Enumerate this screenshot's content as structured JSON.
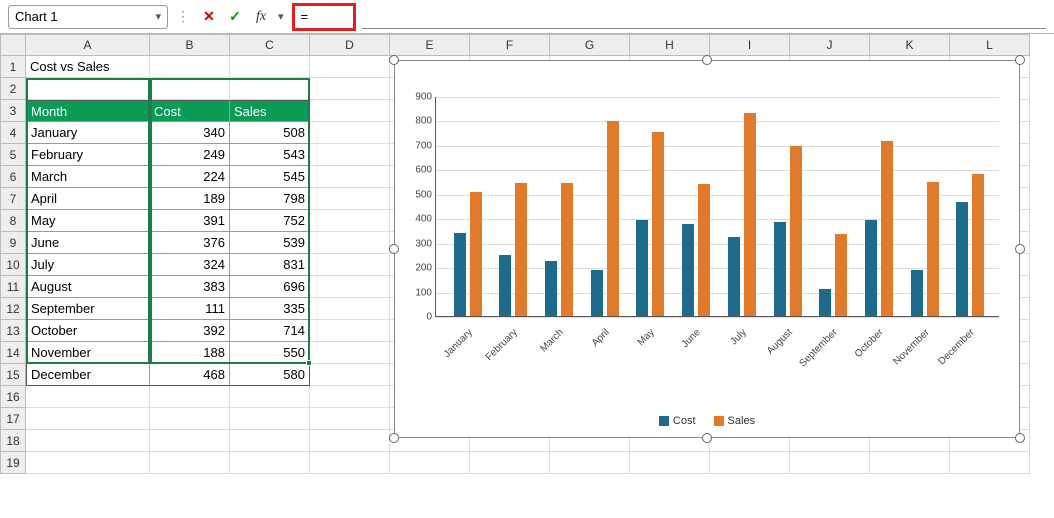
{
  "formula_bar": {
    "name_box": "Chart 1",
    "formula_value": "="
  },
  "columns": [
    "A",
    "B",
    "C",
    "D",
    "E",
    "F",
    "G",
    "H",
    "I",
    "J",
    "K",
    "L"
  ],
  "col_widths": {
    "A": 124,
    "B": 80,
    "C": 80,
    "other": 80
  },
  "row_count": 19,
  "title_cell": "Cost vs Sales",
  "table": {
    "headers": [
      "Month",
      "Cost",
      "Sales"
    ],
    "rows": [
      {
        "month": "January",
        "cost": 340,
        "sales": 508
      },
      {
        "month": "February",
        "cost": 249,
        "sales": 543
      },
      {
        "month": "March",
        "cost": 224,
        "sales": 545
      },
      {
        "month": "April",
        "cost": 189,
        "sales": 798
      },
      {
        "month": "May",
        "cost": 391,
        "sales": 752
      },
      {
        "month": "June",
        "cost": 376,
        "sales": 539
      },
      {
        "month": "July",
        "cost": 324,
        "sales": 831
      },
      {
        "month": "August",
        "cost": 383,
        "sales": 696
      },
      {
        "month": "September",
        "cost": 111,
        "sales": 335
      },
      {
        "month": "October",
        "cost": 392,
        "sales": 714
      },
      {
        "month": "November",
        "cost": 188,
        "sales": 550
      },
      {
        "month": "December",
        "cost": 468,
        "sales": 580
      }
    ]
  },
  "chart_data": {
    "type": "bar",
    "categories": [
      "January",
      "February",
      "March",
      "April",
      "May",
      "June",
      "July",
      "August",
      "September",
      "October",
      "November",
      "December"
    ],
    "series": [
      {
        "name": "Cost",
        "values": [
          340,
          249,
          224,
          189,
          391,
          376,
          324,
          383,
          111,
          392,
          188,
          468
        ],
        "color": "#1f6b8c"
      },
      {
        "name": "Sales",
        "values": [
          508,
          543,
          545,
          798,
          752,
          539,
          831,
          696,
          335,
          714,
          550,
          580
        ],
        "color": "#e07b2e"
      }
    ],
    "ylim": [
      0,
      900
    ],
    "yticks": [
      0,
      100,
      200,
      300,
      400,
      500,
      600,
      700,
      800,
      900
    ],
    "legend": [
      "Cost",
      "Sales"
    ]
  }
}
